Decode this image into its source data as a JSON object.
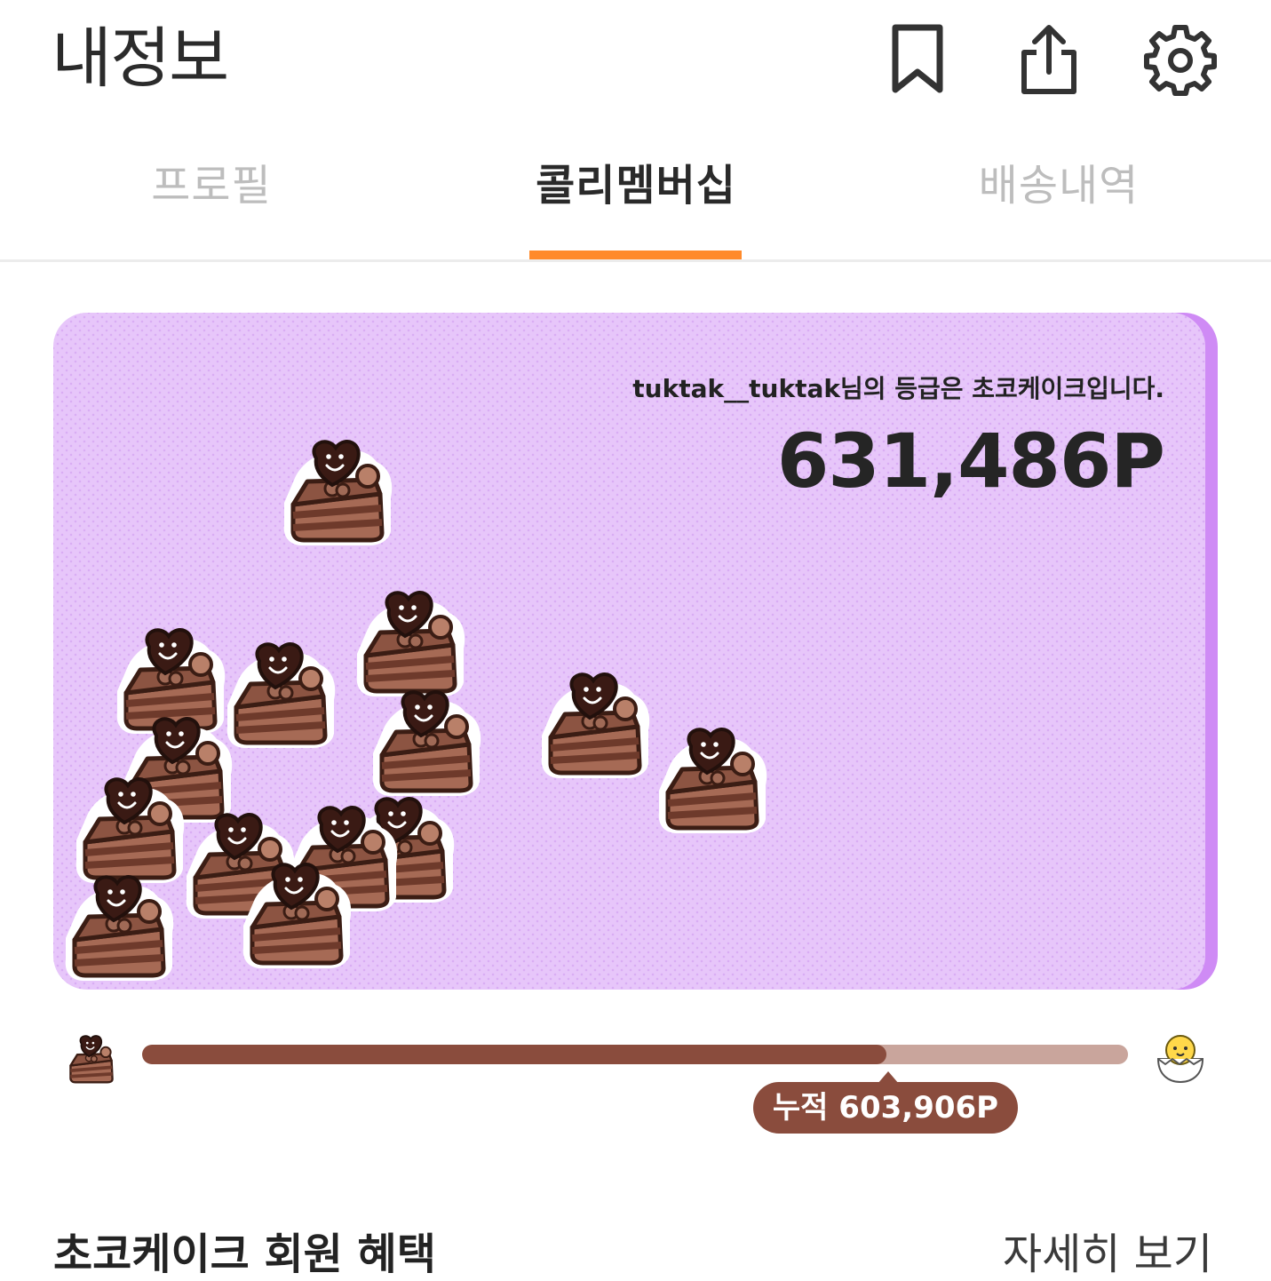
{
  "header": {
    "title": "내정보",
    "icons": [
      "bookmark-icon",
      "share-icon",
      "gear-icon"
    ]
  },
  "tabs": [
    {
      "label": "프로필",
      "active": false
    },
    {
      "label": "콜리멤버십",
      "active": true
    },
    {
      "label": "배송내역",
      "active": false
    }
  ],
  "colors": {
    "accent": "#ff8a2b",
    "card_bg": "#e7c6fa",
    "card_edge": "#cf8bf5",
    "progress_fill": "#8a4c3d",
    "progress_track": "#c9a59c"
  },
  "membership": {
    "grade_message": "tuktak__tuktak님의 등급은 초코케이크입니다.",
    "points": "631,486P",
    "grade_icon": "choco-cake-icon",
    "next_grade_icon": "chick-egg-icon"
  },
  "progress": {
    "fraction": 0.755,
    "accumulated_label": "누적 603,906P"
  },
  "benefits": {
    "title": "초코케이크 회원 혜택",
    "more_label": "자세히 보기"
  }
}
